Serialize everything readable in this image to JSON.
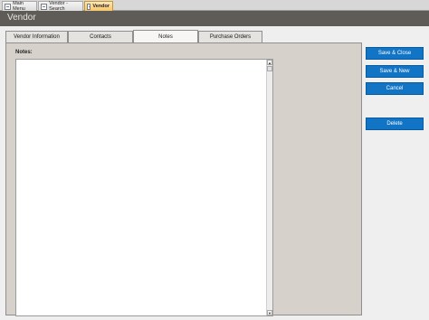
{
  "doc_tabs": [
    {
      "label": "Main Menu",
      "icon": "form-icon"
    },
    {
      "label": "Vendor - Search",
      "icon": "form-icon"
    },
    {
      "label": "Vendor",
      "icon": "form-icon",
      "active": true
    }
  ],
  "header": {
    "title": "Vendor"
  },
  "form_tabs": [
    {
      "label": "Vendor Information"
    },
    {
      "label": "Contacts"
    },
    {
      "label": "Notes",
      "active": true
    },
    {
      "label": "Purchase Orders"
    }
  ],
  "notes": {
    "label": "Notes:",
    "value": ""
  },
  "buttons": {
    "save_close": "Save & Close",
    "save_new": "Save & New",
    "cancel": "Cancel",
    "delete": "Delete"
  },
  "colors": {
    "header_band": "#5f5b57",
    "panel": "#d6d2cb",
    "button": "#1174c5",
    "active_doc_tab": "#f8c66b"
  }
}
